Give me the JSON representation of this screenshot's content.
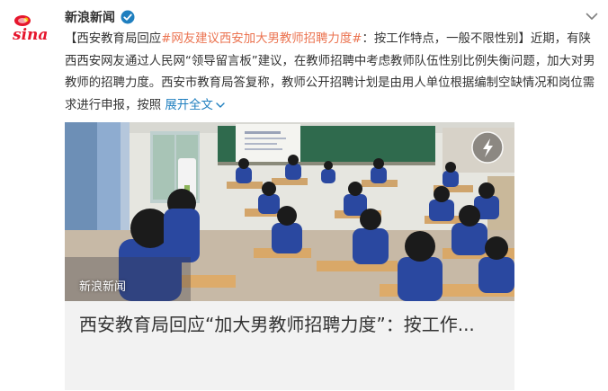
{
  "author": {
    "name": "新浪新闻",
    "logo_text": "sina"
  },
  "post": {
    "bracket_open": "【西安教育局回应",
    "hashtag": "#网友建议西安加大男教师招聘力度#",
    "rest_1": "：按工作特点，一般不限性别】近期，有陕西西安网友通过人民网“领导留言板”建议，在教师招聘中考虑教师队伍性别比例失衡问题，加大对男教师的招聘力度。西安市教育局答复称，教师公开招聘计划是由用人单位根据编制空缺情况和岗位需求进行申报，按照 ",
    "expand_label": "展开全文"
  },
  "card": {
    "watermark": "新浪新闻",
    "title": "西安教育局回应“加大男教师招聘力度”：按工作..."
  },
  "colors": {
    "hashtag": "#eb7350",
    "link": "#1f7fbf",
    "verified": "#1f7fbf"
  },
  "icons": [
    "sina-logo-icon",
    "verified-badge-icon",
    "chevron-down-icon",
    "play-icon"
  ]
}
